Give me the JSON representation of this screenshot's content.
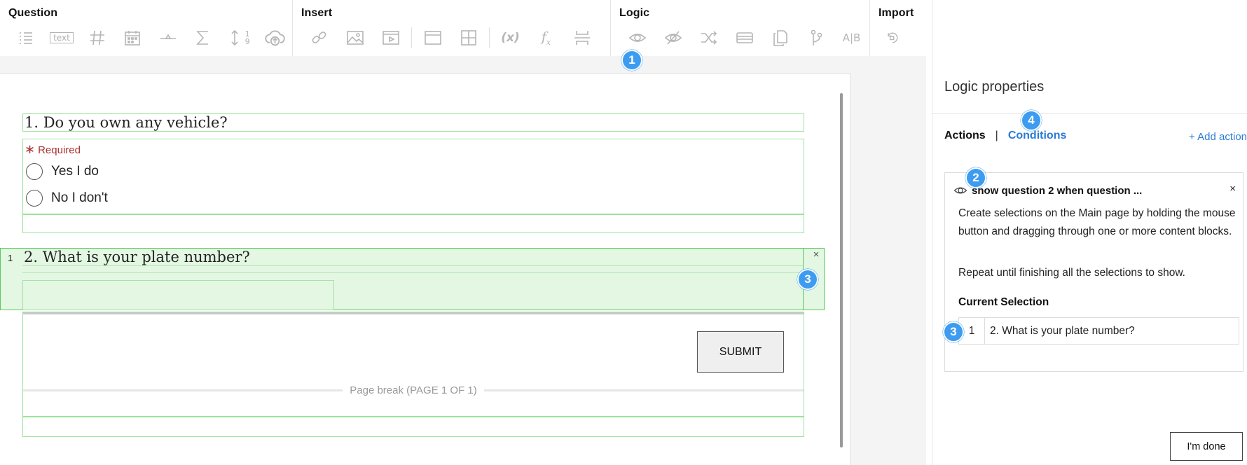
{
  "toolbar": {
    "groups": [
      {
        "title": "Question",
        "icons": [
          "list-icon",
          "text-field-icon",
          "number-hash-icon",
          "calendar-icon",
          "slider-icon",
          "sum-icon",
          "sort-numeric-icon",
          "cloud-upload-icon"
        ]
      },
      {
        "title": "Insert",
        "icons": [
          "link-icon",
          "image-icon",
          "video-icon",
          "section-icon",
          "table-grid-icon",
          "variable-icon",
          "function-icon",
          "page-break-icon"
        ]
      },
      {
        "title": "Logic",
        "icons": [
          "show-eye-icon",
          "hide-eye-icon",
          "shuffle-icon",
          "field-block-icon",
          "copy-icon",
          "branch-icon",
          "ab-split-icon"
        ]
      },
      {
        "title": "Import",
        "icons": [
          "import-icon"
        ]
      }
    ],
    "text_icon_label": "text",
    "ab_label": "A|B",
    "sort_top": "1",
    "sort_bottom": "9"
  },
  "badges": {
    "b1": "1",
    "b2": "2",
    "b3": "3",
    "b4": "4"
  },
  "form": {
    "q1": {
      "title": "1. Do you own any vehicle?",
      "required_mark": "∗",
      "required_label": "Required",
      "options": [
        "Yes I do",
        "No I don't"
      ]
    },
    "q2": {
      "selection_number": "1",
      "title": "2. What is your plate number?",
      "close": "×"
    },
    "submit_label": "SUBMIT",
    "page_break_label": "Page break (PAGE 1 OF 1)"
  },
  "panel": {
    "title": "Logic properties",
    "tab_actions": "Actions",
    "tab_separator": "|",
    "tab_conditions": "Conditions",
    "add_action": "+ Add action",
    "card": {
      "heading": "show question 2 when question ...",
      "close": "×",
      "paragraph1": "Create selections on the Main page by holding the mouse button and dragging through one or more content blocks.",
      "paragraph2": "Repeat until finishing all the selections to show.",
      "current_selection_label": "Current Selection",
      "selection": {
        "number": "1",
        "title": "2. What is your plate number?"
      }
    },
    "done_label": "I'm done"
  },
  "colors": {
    "accent": "#2a7bd4",
    "badge": "#3d9cf0",
    "selection_fill": "#e3f7e3",
    "selection_border": "#5cc95c"
  }
}
